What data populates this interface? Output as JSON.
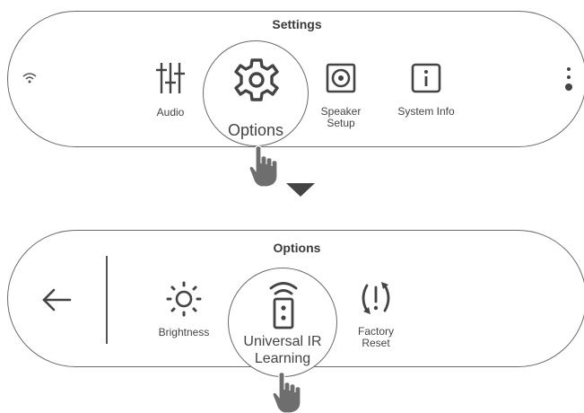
{
  "settings_panel": {
    "title": "Settings",
    "items": [
      {
        "label": "Audio",
        "icon": "equalizer-icon"
      },
      {
        "label": "Options",
        "icon": "gear-icon"
      },
      {
        "label": "Speaker\nSetup",
        "icon": "speaker-icon"
      },
      {
        "label": "System Info",
        "icon": "info-icon"
      }
    ],
    "left_icon": "wifi-icon",
    "right_icon": "more-vertical-icon"
  },
  "options_panel": {
    "title": "Options",
    "back_icon": "back-arrow-icon",
    "items": [
      {
        "label": "Brightness",
        "icon": "sun-icon"
      },
      {
        "label": "Universal IR\nLearning",
        "icon": "remote-icon"
      },
      {
        "label": "Factory\nReset",
        "icon": "reset-icon"
      }
    ]
  },
  "indicators": {
    "hand_icon": "hand-tap-icon",
    "arrow_icon": "arrow-down-icon"
  },
  "colors": {
    "stroke": "#555555",
    "background": "#ffffff",
    "text": "#444444"
  }
}
